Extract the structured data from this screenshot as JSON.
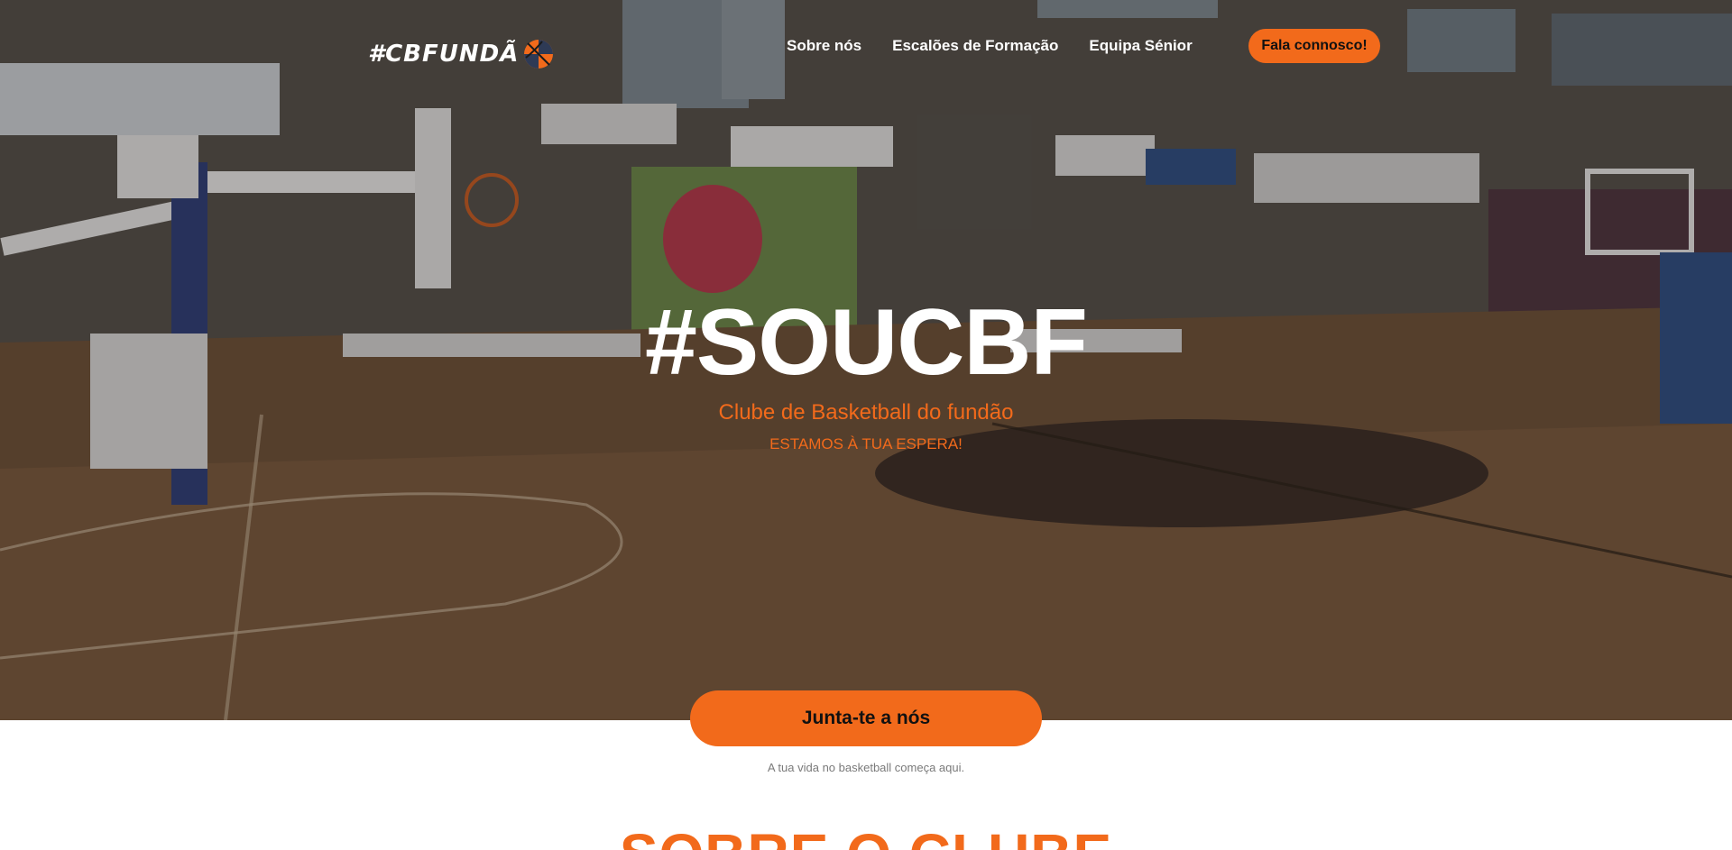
{
  "brand": {
    "logo_text": "#CBFUNDÃ",
    "accent_color": "#f26a1b"
  },
  "nav": {
    "links": [
      "Sobre nós",
      "Escalões de Formação",
      "Equipa Sénior"
    ],
    "cta_label": "Fala connosco!"
  },
  "hero": {
    "title": "#SOUCBF",
    "subtitle": "Clube de Basketball do fundão",
    "tagline": "ESTAMOS À TUA ESPERA!"
  },
  "join": {
    "button_label": "Junta-te a nós",
    "caption": "A tua vida no basketball começa aqui."
  },
  "about": {
    "title": "SOBRE O CLUBE"
  }
}
